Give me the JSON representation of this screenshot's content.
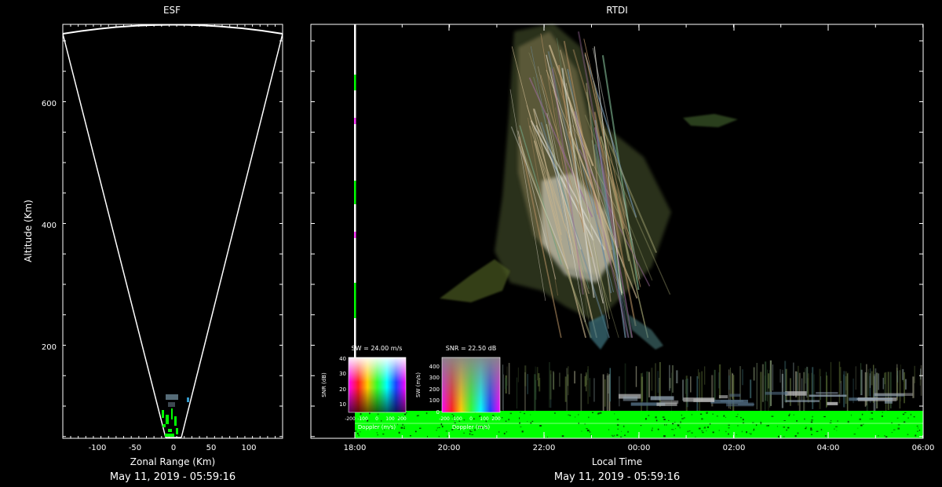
{
  "colors": {
    "background": "#000000",
    "foreground": "#ffffff",
    "ground_clutter": "#00ff00"
  },
  "esf": {
    "title": "ESF",
    "xlabel": "Zonal Range (Km)",
    "ylabel": "Altitude (Km)",
    "timestamp": "May 11, 2019 - 05:59:16",
    "xticks": [
      "-100",
      "-50",
      "0",
      "50",
      "100"
    ],
    "yticks": [
      "200",
      "400",
      "600"
    ]
  },
  "rtdi": {
    "title": "RTDI",
    "xlabel": "Local Time",
    "timestamp": "May 11, 2019 - 05:59:16",
    "xticks": [
      "18:00",
      "20:00",
      "22:00",
      "00:00",
      "02:00",
      "04:00",
      "06:00"
    ]
  },
  "legend_sw": {
    "title": "SW = 24.00 m/s",
    "ylabel": "SNR (dB)",
    "xlabel": "Doppler (m/s)",
    "yticks": [
      "40",
      "30",
      "20",
      "10"
    ],
    "xticks": [
      "-200",
      "-100",
      "0",
      "100",
      "200"
    ]
  },
  "legend_snr": {
    "title": "SNR = 22.50 dB",
    "ylabel": "SW (m/s)",
    "xlabel": "Doppler (m/s)",
    "yticks": [
      "400",
      "300",
      "200",
      "100",
      "0"
    ],
    "xticks": [
      "-200",
      "-100",
      "0",
      "100",
      "200"
    ]
  },
  "chart_data": [
    {
      "type": "heatmap",
      "title": "ESF",
      "xlabel": "Zonal Range (Km)",
      "ylabel": "Altitude (Km)",
      "xlim": [
        -145,
        145
      ],
      "ylim": [
        50,
        725
      ],
      "xticks": [
        -100,
        -50,
        0,
        50,
        100
      ],
      "yticks": [
        200,
        400,
        600
      ],
      "scan_wedge_edges_km": [
        [
          -145,
          715
        ],
        [
          0,
          50
        ],
        [
          145,
          715
        ]
      ],
      "echo_regions": [
        {
          "x_range": [
            -20,
            10
          ],
          "y_range": [
            55,
            120
          ],
          "dominant": "ground-clutter green"
        }
      ]
    },
    {
      "type": "heatmap",
      "title": "RTDI",
      "xlabel": "Local Time",
      "x_range_hours": [
        17.0,
        30.0
      ],
      "xticks": [
        "18:00",
        "20:00",
        "22:00",
        "00:00",
        "02:00",
        "04:00",
        "06:00"
      ],
      "ylim": [
        50,
        725
      ],
      "features": [
        {
          "name": "plume",
          "time_start": "20:30",
          "time_end": "23:40",
          "alt_range": [
            230,
            720
          ]
        },
        {
          "name": "bottomside",
          "time_start": "20:00",
          "time_end": "06:00",
          "alt_range": [
            75,
            140
          ]
        },
        {
          "name": "ground-clutter",
          "time_start": "18:00",
          "time_end": "06:00",
          "alt_range": [
            50,
            92
          ]
        }
      ]
    }
  ]
}
